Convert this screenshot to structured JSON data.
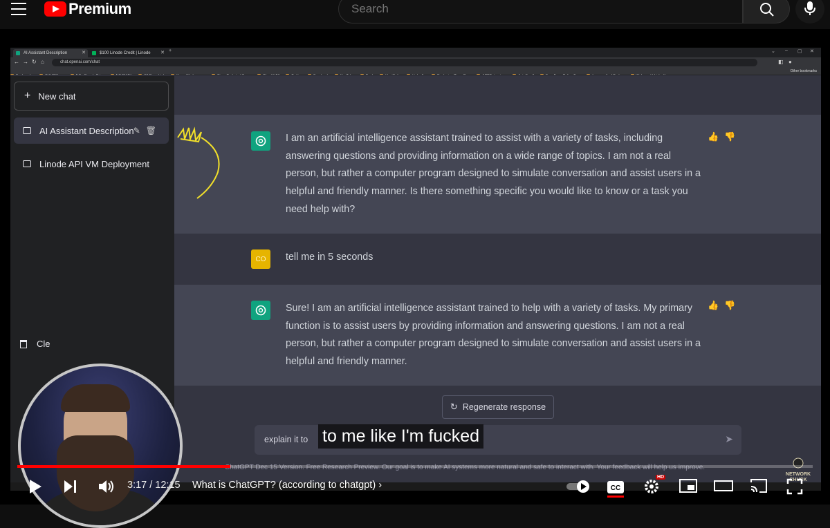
{
  "youtube": {
    "brand": "Premium",
    "search_placeholder": "Search"
  },
  "browser": {
    "tabs": [
      {
        "title": "AI Assistant Description"
      },
      {
        "title": "$100 Linode Credit | Linode"
      }
    ],
    "address": "chat.openai.com/chat",
    "bookmarks": [
      "Bookmarks",
      "CHUCKlaws",
      "NC - Google Drive",
      "NC EMAIL",
      "CJ Deep Link",
      "Kasm Workspaces",
      "Cisco Technical Sup...",
      "ChuckNAS",
      "Twitter",
      "Facebook",
      "YouTube",
      "Bank",
      "HootSuite",
      "LinkedIn",
      "Deploying Cisco Co...",
      "ACRExtensions",
      "AutoScroll",
      "Free Fax • Online Fa...",
      "Improve the Windo...",
      "Welcome! | LinkedIn"
    ],
    "other_bookmarks": "Other bookmarks"
  },
  "sidebar": {
    "new_chat": "New chat",
    "conversations": [
      {
        "title": "AI Assistant Description"
      },
      {
        "title": "Linode API VM Deployment"
      }
    ],
    "clear_partial": "Cle"
  },
  "chat": {
    "messages": [
      {
        "role": "assistant",
        "text": "I am an artificial intelligence assistant trained to assist with a variety of tasks, including answering questions and providing information on a wide range of topics. I am not a real person, but rather a computer program designed to simulate conversation and assist users in a helpful and friendly manner. Is there something specific you would like to know or a task you need help with?"
      },
      {
        "role": "user",
        "avatar": "CO",
        "text": "tell me in 5 seconds"
      },
      {
        "role": "assistant",
        "text": "Sure! I am an artificial intelligence assistant trained to help with a variety of tasks. My primary function is to assist users by providing information and answering questions. I am not a real person, but rather a computer program designed to simulate conversation and assist users in a helpful and friendly manner."
      }
    ],
    "regenerate": "Regenerate response",
    "composer_value": "explain it to",
    "footnote": "ChatGPT Dec 15 Version. Free Research Preview. Our goal is to make AI systems more natural and safe to interact with. Your feedback will help us improve."
  },
  "caption": "to me like I'm fucked",
  "player": {
    "time": "3:17 / 12:15",
    "title": "What is ChatGPT? (according to chatgpt)",
    "progress": 0.268,
    "hd": "HD",
    "watermark": "NETWORK CHUCK"
  },
  "colors": {
    "youtube_red": "#ff0000",
    "chatgpt_green": "#10a37f",
    "user_avatar": "#e6b400",
    "annotation": "#f2e02a"
  }
}
